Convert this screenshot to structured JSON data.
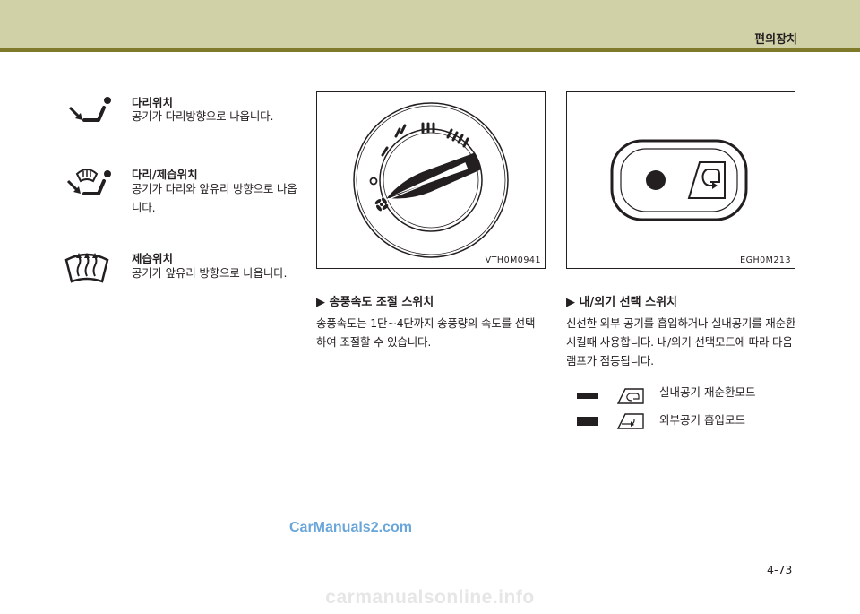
{
  "header": {
    "section_title": "편의장치"
  },
  "modes": [
    {
      "title": "다리위치",
      "desc": "공기가 다리방향으로 나옵니다.",
      "icon": "foot-vent-icon"
    },
    {
      "title": "다리/제습위치",
      "desc": "공기가 다리와 앞유리 방향으로 나옵니다.",
      "icon": "foot-defrost-icon"
    },
    {
      "title": "제습위치",
      "desc": "공기가 앞유리 방향으로 나옵니다.",
      "icon": "windshield-defrost-icon"
    }
  ],
  "figures": {
    "fan": {
      "code": "VTH0M0941",
      "ticks": [
        "I",
        "II",
        "III",
        "IIII"
      ]
    },
    "recirc": {
      "code": "EGH0M213"
    }
  },
  "fan_section": {
    "heading": "▶ 송풍속도 조절 스위치",
    "body": "송풍속도는 1단~4단까지 송풍량의 속도를 선택하여 조절할 수 있습니다."
  },
  "intake_section": {
    "heading": "▶ 내/외기 선택 스위치",
    "body": "신선한 외부 공기를 흡입하거나 실내공기를 재순환시킬때 사용합니다. 내/외기 선택모드에 따라 다음 램프가 점등됩니다.",
    "legend": [
      {
        "label": "실내공기 재순환모드",
        "icon": "recirculation-icon"
      },
      {
        "label": "외부공기 흡입모드",
        "icon": "fresh-air-icon"
      }
    ]
  },
  "watermark": "CarManuals2.com",
  "footer_watermark": "carmanualsonline.info",
  "page_number": "4-73"
}
